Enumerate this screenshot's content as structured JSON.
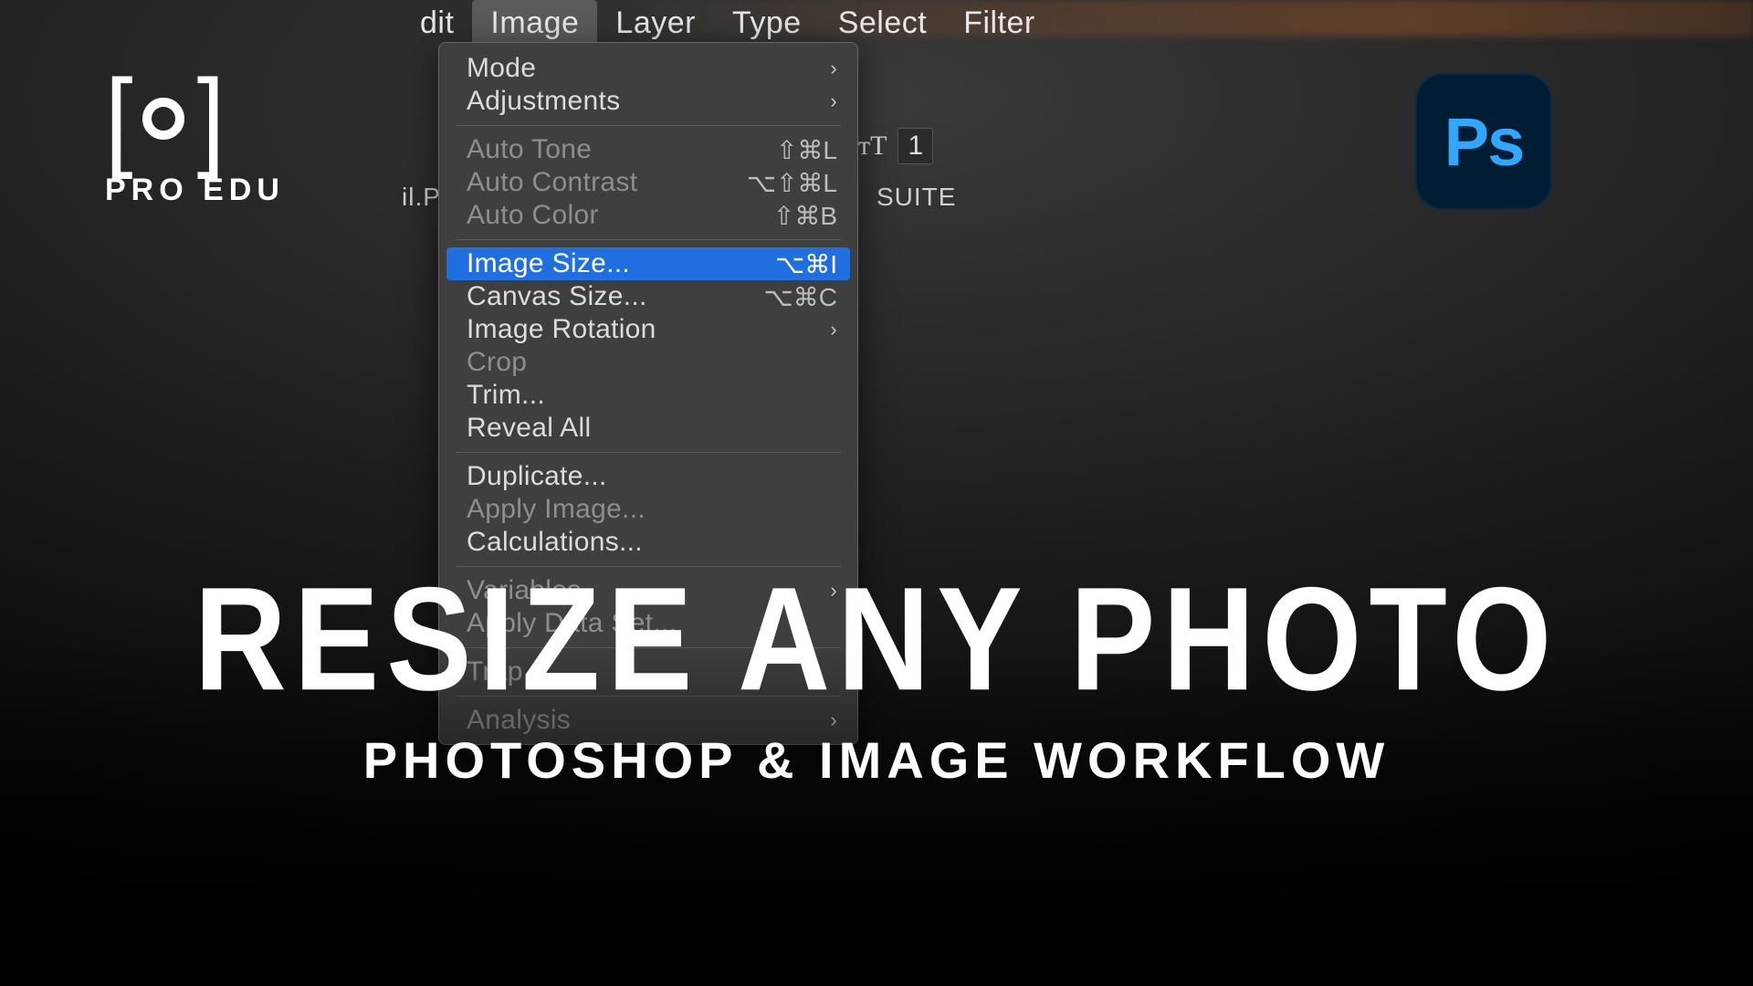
{
  "menubar": {
    "edit": "dit",
    "image": "Image",
    "layer": "Layer",
    "type": "Type",
    "select": "Select",
    "filter": "Filter"
  },
  "toolbar": {
    "type_icon": "ᴛT",
    "field_value": "1",
    "tab_left": "il.PS",
    "tab_right": "SUITE"
  },
  "dropdown": {
    "mode": "Mode",
    "adjustments": "Adjustments",
    "auto_tone": "Auto Tone",
    "auto_tone_sc": "⇧⌘L",
    "auto_contrast": "Auto Contrast",
    "auto_contrast_sc": "⌥⇧⌘L",
    "auto_color": "Auto Color",
    "auto_color_sc": "⇧⌘B",
    "image_size": "Image Size...",
    "image_size_sc": "⌥⌘I",
    "canvas_size": "Canvas Size...",
    "canvas_size_sc": "⌥⌘C",
    "image_rotation": "Image Rotation",
    "crop": "Crop",
    "trim": "Trim...",
    "reveal_all": "Reveal All",
    "duplicate": "Duplicate...",
    "apply_image": "Apply Image...",
    "calculations": "Calculations...",
    "variables": "Variables",
    "apply_data_set": "Apply Data Set...",
    "trap": "Trap...",
    "analysis": "Analysis"
  },
  "logos": {
    "proedu": "PRO EDU",
    "ps": "Ps"
  },
  "headline": {
    "h1": "RESIZE ANY PHOTO",
    "h2": "PHOTOSHOP & IMAGE WORKFLOW"
  },
  "chevron": "›"
}
